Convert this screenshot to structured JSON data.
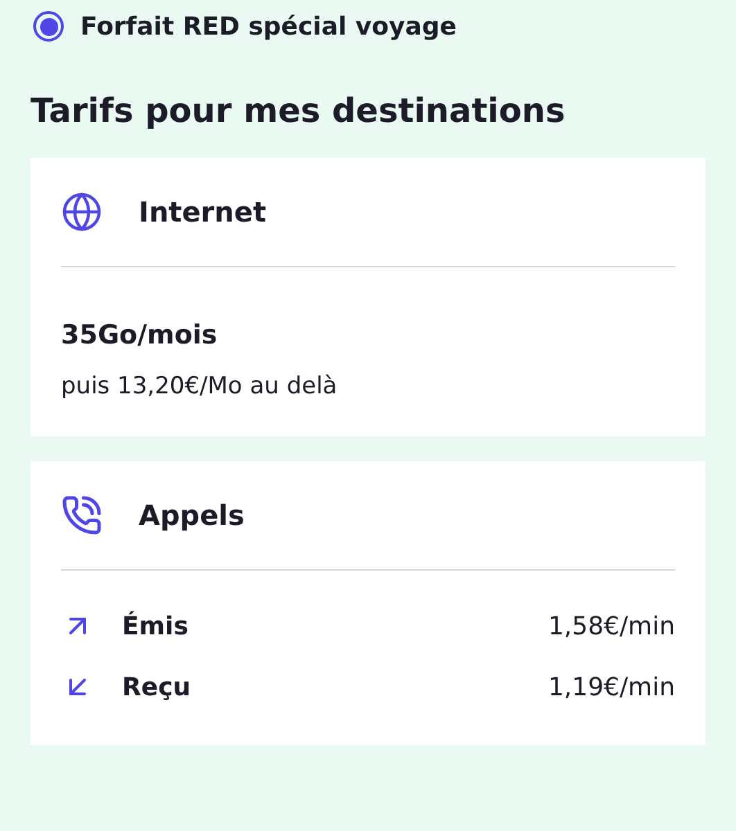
{
  "plan": {
    "label": "Forfait RED spécial voyage",
    "selected": true
  },
  "heading": "Tarifs pour mes destinations",
  "internet": {
    "title": "Internet",
    "allowance": "35Go/mois",
    "overage": "puis 13,20€/Mo au delà"
  },
  "calls": {
    "title": "Appels",
    "rows": [
      {
        "kind": "outgoing",
        "label": "Émis",
        "price": "1,58€/min"
      },
      {
        "kind": "incoming",
        "label": "Reçu",
        "price": "1,19€/min"
      }
    ]
  }
}
